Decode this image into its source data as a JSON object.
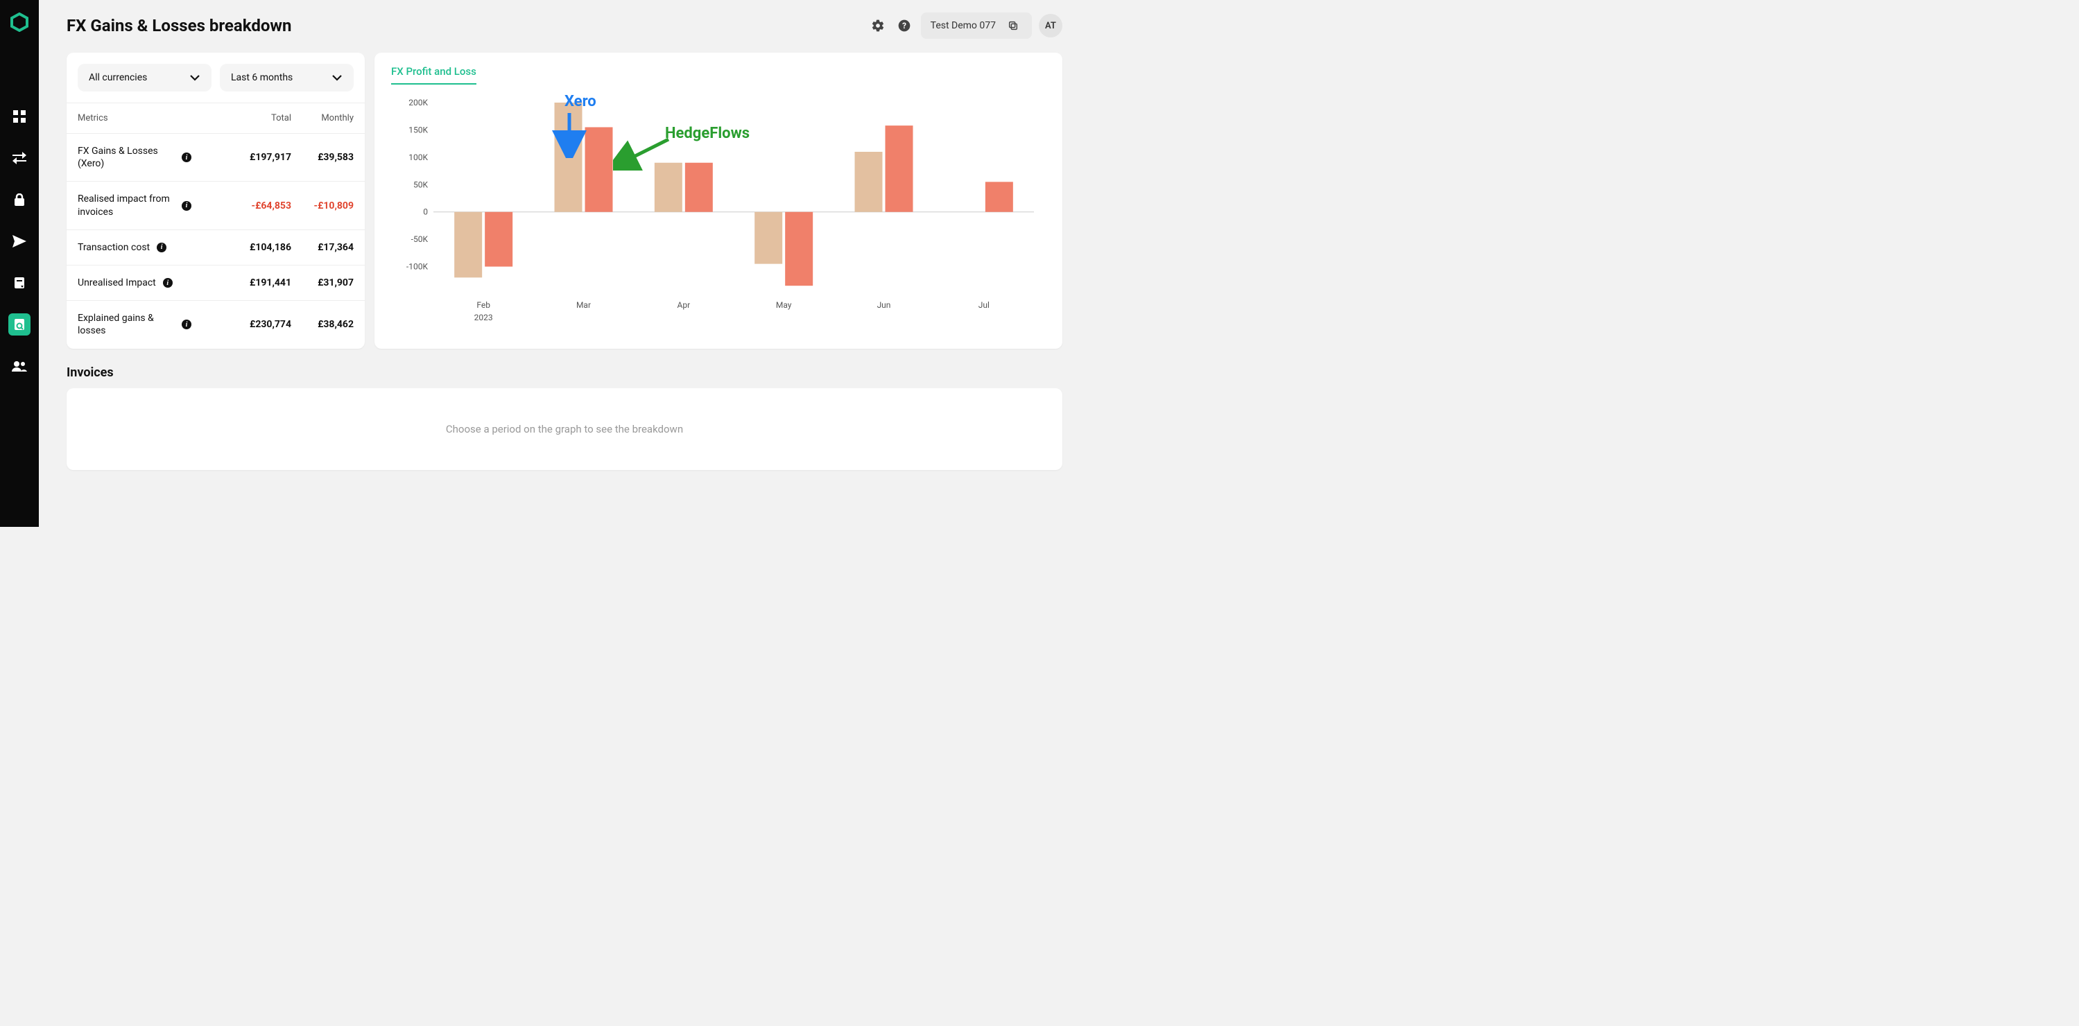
{
  "page_title": "FX Gains & Losses breakdown",
  "top_right": {
    "org_name": "Test Demo 077",
    "avatar_initials": "AT"
  },
  "filters": {
    "currency": "All currencies",
    "period": "Last 6 months"
  },
  "metrics": {
    "header": {
      "label": "Metrics",
      "total": "Total",
      "monthly": "Monthly"
    },
    "rows": [
      {
        "label": "FX Gains & Losses (Xero)",
        "total": "£197,917",
        "monthly": "£39,583"
      },
      {
        "label": "Realised impact from invoices",
        "total": "-£64,853",
        "monthly": "-£10,809",
        "negative": true
      },
      {
        "label": "Transaction cost",
        "total": "£104,186",
        "monthly": "£17,364"
      },
      {
        "label": "Unrealised Impact",
        "total": "£191,441",
        "monthly": "£31,907"
      },
      {
        "label": "Explained gains & losses",
        "total": "£230,774",
        "monthly": "£38,462"
      }
    ]
  },
  "chart": {
    "tab_label": "FX Profit and Loss",
    "annotations": {
      "xero": "Xero",
      "hedgeflows": "HedgeFlows"
    }
  },
  "chart_data": {
    "type": "bar",
    "categories": [
      "Feb",
      "Mar",
      "Apr",
      "May",
      "Jun",
      "Jul"
    ],
    "year_label": "2023",
    "ylim": [
      -150000,
      200000
    ],
    "yticks": [
      -100000,
      -50000,
      0,
      50000,
      100000,
      150000,
      200000
    ],
    "ytick_labels": [
      "-100K",
      "-50K",
      "0",
      "50K",
      "100K",
      "150K",
      "200K"
    ],
    "series": [
      {
        "name": "Xero",
        "color": "#e3c0a0",
        "values": [
          -120000,
          200000,
          90000,
          -95000,
          110000,
          null
        ]
      },
      {
        "name": "HedgeFlows",
        "color": "#f0806a",
        "values": [
          -100000,
          155000,
          90000,
          -135000,
          158000,
          55000
        ]
      }
    ]
  },
  "invoices": {
    "title": "Invoices",
    "placeholder": "Choose a period on the graph to see the breakdown"
  }
}
